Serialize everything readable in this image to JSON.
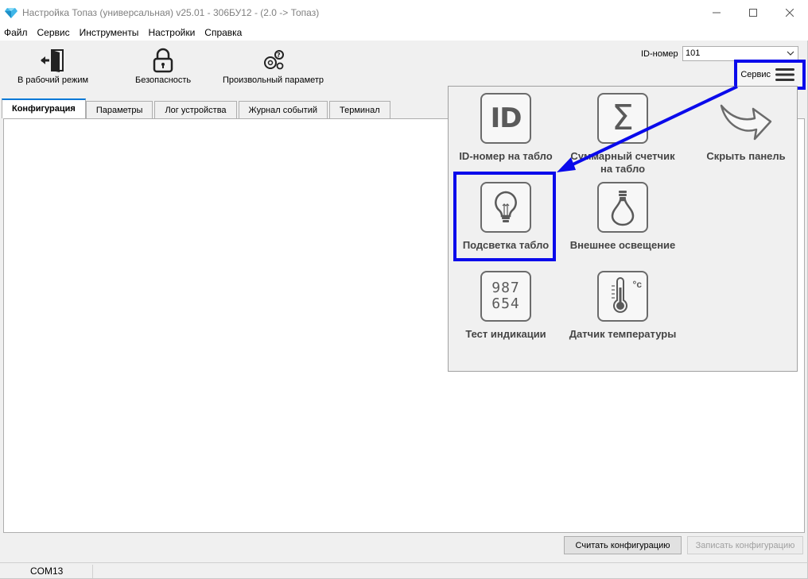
{
  "window": {
    "title": "Настройка Топаз (универсальная) v25.01 - 306БУ12 - (2.0 -> Топаз)"
  },
  "menu": [
    "Файл",
    "Сервис",
    "Инструменты",
    "Настройки",
    "Справка"
  ],
  "toolbar": {
    "work_mode": "В рабочий режим",
    "security": "Безопасность",
    "custom_param": "Произвольный параметр",
    "id_label": "ID-номер",
    "id_value": "101",
    "service_label": "Сервис"
  },
  "tabs": [
    "Конфигурация",
    "Параметры",
    "Лог устройства",
    "Журнал событий",
    "Терминал"
  ],
  "active_tab": 0,
  "service_panel": {
    "tiles": [
      {
        "label": "ID-номер на табло",
        "icon": "id-icon"
      },
      {
        "label": "Суммарный счетчик на табло",
        "icon": "sigma-icon"
      },
      {
        "label": "Скрыть панель",
        "icon": "curved-arrow-icon"
      },
      {
        "label": "Подсветка табло",
        "icon": "lightbulb-icon"
      },
      {
        "label": "Внешнее освещение",
        "icon": "bulb-outline-icon"
      },
      {
        "label": "Тест индикации",
        "icon": "digits-icon"
      },
      {
        "label": "Датчик температуры",
        "icon": "thermometer-icon"
      }
    ],
    "digits_top": "987",
    "digits_bottom": "654",
    "id_glyph": "ID",
    "sigma_glyph": "Σ",
    "celsius_glyph": "°c"
  },
  "buttons": {
    "read_config": "Считать конфигурацию",
    "write_config": "Записать конфигурацию"
  },
  "status": {
    "port": "COM13"
  },
  "colors": {
    "highlight": "#0a0aeb",
    "tab_accent": "#0078d7",
    "icon_stroke": "#6b6b6b"
  }
}
